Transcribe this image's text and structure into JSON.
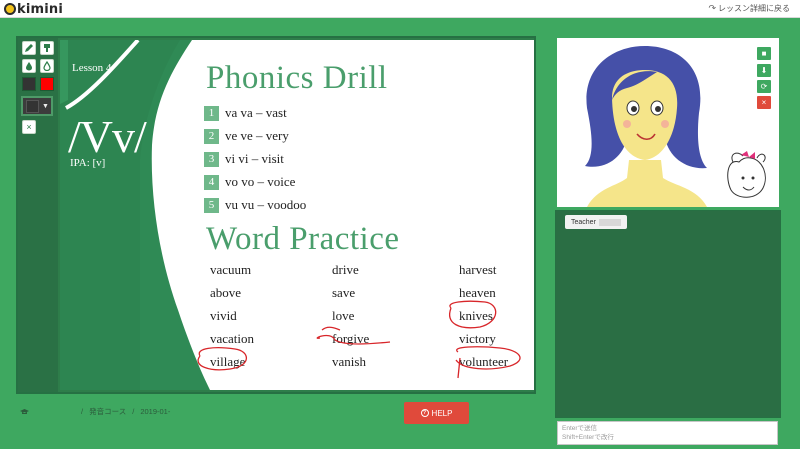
{
  "app": {
    "logo_text": "kimini",
    "back_link": "レッスン詳細に戻る"
  },
  "slide": {
    "lesson_label": "Lesson 4",
    "letter": "/Vv/",
    "ipa": "IPA: [v]",
    "drill_title": "Phonics Drill",
    "drill_items": [
      {
        "num": "1",
        "text": "va va – vast"
      },
      {
        "num": "2",
        "text": "ve ve – very"
      },
      {
        "num": "3",
        "text": "vi vi – visit"
      },
      {
        "num": "4",
        "text": "vo vo – voice"
      },
      {
        "num": "5",
        "text": "vu vu – voodoo"
      }
    ],
    "practice_title": "Word Practice",
    "words": [
      [
        "vacuum",
        "drive",
        "harvest"
      ],
      [
        "above",
        "save",
        "heaven"
      ],
      [
        "vivid",
        "love",
        "knives"
      ],
      [
        "vacation",
        "forgive",
        "victory"
      ],
      [
        "village",
        "vanish",
        "volunteer"
      ]
    ]
  },
  "tools": {
    "pen_icon": "pencil-icon",
    "eraser_icon": "eraser-icon",
    "fill_icon": "drop-outline-icon",
    "fill2_icon": "drop-fill-icon",
    "colors": [
      "#333333",
      "#ff0000"
    ],
    "clear_label": "×"
  },
  "video_controls": [
    {
      "icon": "camera-icon",
      "color": "#3ea860"
    },
    {
      "icon": "download-icon",
      "color": "#3ea860"
    },
    {
      "icon": "refresh-icon",
      "color": "#3ea860"
    },
    {
      "icon": "close-icon",
      "color": "#e04a3b"
    }
  ],
  "chat": {
    "sender": "Teacher",
    "input_placeholder": "Enterで送信\nShift+Enterで改行"
  },
  "footer": {
    "crumbs": [
      "/",
      "発音コース",
      "/",
      "2019-01-"
    ],
    "help_label": "HELP"
  }
}
